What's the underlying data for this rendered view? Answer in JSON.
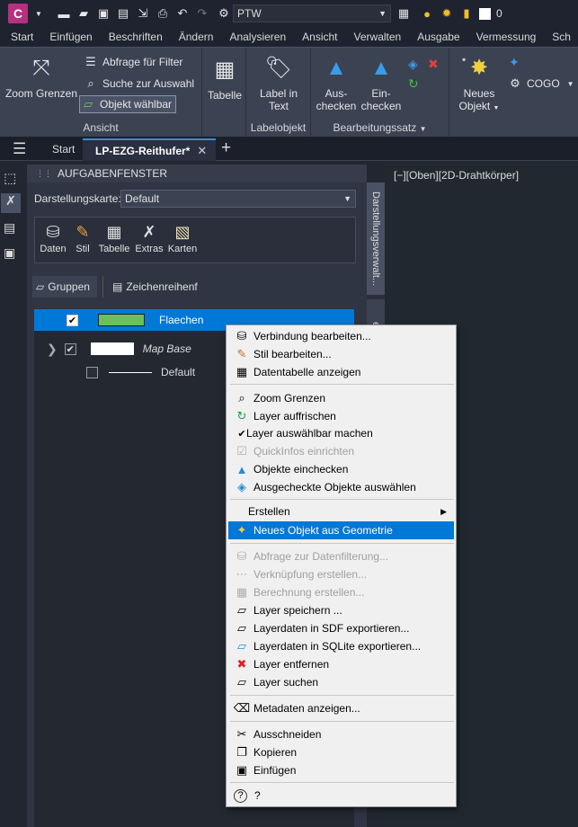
{
  "app": {
    "logo_letter": "C",
    "workspace": "PTW",
    "layer_value": "0"
  },
  "menu_tabs": [
    "Start",
    "Einfügen",
    "Beschriften",
    "Ändern",
    "Analysieren",
    "Ansicht",
    "Verwalten",
    "Ausgabe",
    "Vermessung",
    "Sch"
  ],
  "ribbon": {
    "ansicht": {
      "title": "Ansicht",
      "zoom_label": "Zoom Grenzen",
      "abfrage_label": "Abfrage für Filter",
      "suche_label": "Suche zur Auswahl",
      "objekt_label": "Objekt wählbar"
    },
    "tabelle_label": "Tabelle",
    "labelobjekt": {
      "title": "Labelobjekt",
      "label_btn": "Label in",
      "label_btn2": "Text"
    },
    "bearbeitungssatz": {
      "title": "Bearbeitungssatz",
      "aus_label": "Aus-",
      "aus_label2": "checken",
      "ein_label": "Ein-",
      "ein_label2": "checken"
    },
    "neues_label": "Neues",
    "neues_label2": "Objekt",
    "cogo_label": "COGO"
  },
  "file_tabs": {
    "start": "Start",
    "active": "LP-EZG-Reithufer*",
    "add": "+"
  },
  "viewport_label": "[−][Oben][2D-Drahtkörper]",
  "taskpane": {
    "title": "AUFGABENFENSTER",
    "darstellung_label": "Darstellungskarte:",
    "darstellung_value": "Default",
    "tools": [
      "Daten",
      "Stil",
      "Tabelle",
      "Extras",
      "Karten"
    ],
    "gruppen_label": "Gruppen",
    "zeichen_label": "Zeichenreihenf",
    "vtab1": "Darstellungsverwalt...",
    "vtab2": "er"
  },
  "tree": {
    "row1": "Flaechen",
    "row2": "Map Base",
    "row3": "Default"
  },
  "context_menu": {
    "items": [
      "Verbindung bearbeiten...",
      "Stil bearbeiten...",
      "Datentabelle anzeigen",
      "Zoom Grenzen",
      "Layer auffrischen",
      "Layer auswählbar machen",
      "QuickInfos einrichten",
      "Objekte einchecken",
      "Ausgecheckte Objekte auswählen",
      "Erstellen",
      "Neues Objekt aus Geometrie",
      "Abfrage zur Datenfilterung...",
      "Verknüpfung erstellen...",
      "Berechnung erstellen...",
      "Layer speichern ...",
      "Layerdaten in SDF exportieren...",
      "Layerdaten in SQLite exportieren...",
      "Layer entfernen",
      "Layer suchen",
      "Metadaten anzeigen...",
      "Ausschneiden",
      "Kopieren",
      "Einfügen",
      "?"
    ]
  },
  "colors": {
    "accent": "#0078d7",
    "flaechen_fill": "#6cbf5c",
    "app_logo": "#b5307e"
  }
}
